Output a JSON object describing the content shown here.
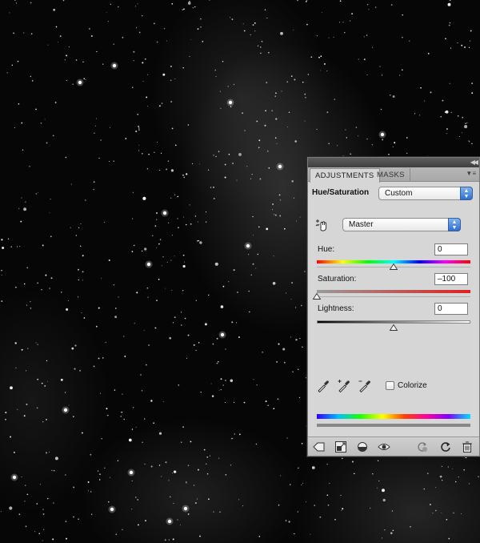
{
  "panel": {
    "tabs": [
      {
        "label": "ADJUSTMENTS",
        "active": true
      },
      {
        "label": "MASKS",
        "active": false
      }
    ],
    "menu_icon": "panel-menu-icon",
    "collapse_icon": "collapse-icon"
  },
  "adjustment": {
    "title": "Hue/Saturation",
    "preset": "Custom",
    "channel": "Master",
    "hue": {
      "label": "Hue:",
      "value": "0",
      "slider_fraction": 0.5
    },
    "saturation": {
      "label": "Saturation:",
      "value": "–100",
      "slider_fraction": 0.0
    },
    "lightness": {
      "label": "Lightness:",
      "value": "0",
      "slider_fraction": 0.5
    },
    "colorize": {
      "label": "Colorize",
      "checked": false
    }
  },
  "icons": {
    "tool": "targeted-adjustment-hand-icon",
    "eyedroppers": [
      "eyedropper-icon",
      "eyedropper-plus-icon",
      "eyedropper-minus-icon"
    ],
    "bottom": [
      "back-arrow-icon",
      "expand-view-icon",
      "clip-layer-icon",
      "visibility-eye-icon",
      "previous-state-icon",
      "reset-icon",
      "trash-icon"
    ]
  },
  "colors": {
    "accent": "#3a78d8",
    "panel_bg": "#d6d6d6"
  }
}
